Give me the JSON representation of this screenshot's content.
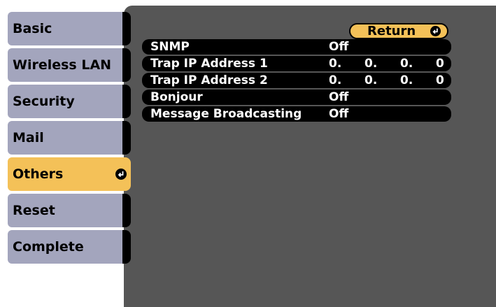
{
  "tabs": [
    {
      "label": "Basic"
    },
    {
      "label": "Wireless LAN"
    },
    {
      "label": "Security"
    },
    {
      "label": "Mail"
    },
    {
      "label": "Others",
      "active": true
    },
    {
      "label": "Reset"
    },
    {
      "label": "Complete"
    }
  ],
  "return_button": {
    "label": "Return",
    "icon": "enter-icon"
  },
  "settings": {
    "snmp": {
      "label": "SNMP",
      "value": "Off"
    },
    "trap1": {
      "label": "Trap IP Address 1",
      "octets": [
        "0.",
        "0.",
        "0.",
        "0"
      ]
    },
    "trap2": {
      "label": "Trap IP Address 2",
      "octets": [
        "0.",
        "0.",
        "0.",
        "0"
      ]
    },
    "bonjour": {
      "label": "Bonjour",
      "value": "Off"
    },
    "message_broadcasting": {
      "label": "Message Broadcasting",
      "value": "Off"
    }
  },
  "colors": {
    "active_tab": "#f4c158",
    "inactive_tab": "#a3a5bd",
    "panel_background": "#565656",
    "row_background": "#000000",
    "text_light": "#ffffff"
  }
}
